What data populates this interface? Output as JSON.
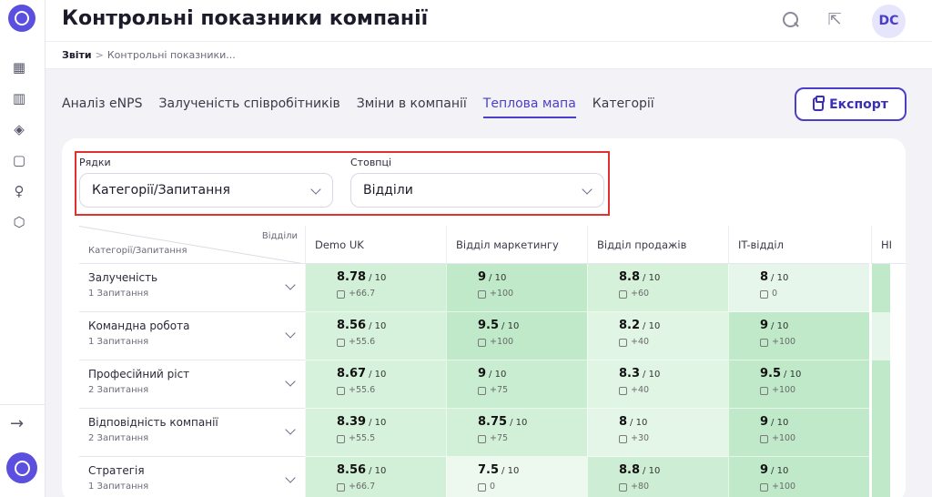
{
  "header": {
    "title": "Контрольні показники компанії",
    "user_initials": "DC"
  },
  "breadcrumb": {
    "root": "Звіти",
    "separator": ">",
    "current": "Контрольні показники..."
  },
  "tabs": [
    {
      "label": "Аналіз eNPS",
      "active": false
    },
    {
      "label": "Залученість співробітників",
      "active": false
    },
    {
      "label": "Зміни в компанії",
      "active": false
    },
    {
      "label": "Теплова мапа",
      "active": true
    },
    {
      "label": "Категорії",
      "active": false
    }
  ],
  "export_label": "Експорт",
  "filters": {
    "rows": {
      "label": "Рядки",
      "value": "Категорії/Запитання"
    },
    "columns": {
      "label": "Стовпці",
      "value": "Відділи"
    }
  },
  "table": {
    "corner_top": "Відділи",
    "corner_bottom": "Категорії/Запитання",
    "columns": [
      "Demo UK",
      "Відділ маркетингу",
      "Відділ продажів",
      "IT-відділ",
      "HI"
    ],
    "rows": [
      {
        "name": "Залученість",
        "sub": "1 Запитання",
        "cells": [
          {
            "score": "8.78",
            "of": "/ 10",
            "delta": "+66.7",
            "color": "#d2f0d8"
          },
          {
            "score": "9",
            "of": "/ 10",
            "delta": "+100",
            "color": "#bfe9c8"
          },
          {
            "score": "8.8",
            "of": "/ 10",
            "delta": "+60",
            "color": "#d5f1da"
          },
          {
            "score": "8",
            "of": "/ 10",
            "delta": "0",
            "color": "#e7f6ea"
          }
        ],
        "edge": "#bfe9c8"
      },
      {
        "name": "Командна робота",
        "sub": "1 Запитання",
        "cells": [
          {
            "score": "8.56",
            "of": "/ 10",
            "delta": "+55.6",
            "color": "#d7f2dc"
          },
          {
            "score": "9.5",
            "of": "/ 10",
            "delta": "+100",
            "color": "#bfe9c8"
          },
          {
            "score": "8.2",
            "of": "/ 10",
            "delta": "+40",
            "color": "#e1f5e5"
          },
          {
            "score": "9",
            "of": "/ 10",
            "delta": "+100",
            "color": "#bfe9c8"
          }
        ],
        "edge": "#e7f6ea"
      },
      {
        "name": "Професійний ріст",
        "sub": "2 Запитання",
        "cells": [
          {
            "score": "8.67",
            "of": "/ 10",
            "delta": "+55.6",
            "color": "#d7f2dc"
          },
          {
            "score": "9",
            "of": "/ 10",
            "delta": "+75",
            "color": "#c9edd1"
          },
          {
            "score": "8.3",
            "of": "/ 10",
            "delta": "+40",
            "color": "#e1f5e5"
          },
          {
            "score": "9.5",
            "of": "/ 10",
            "delta": "+100",
            "color": "#bfe9c8"
          }
        ],
        "edge": "#bfe9c8"
      },
      {
        "name": "Відповідність компанії",
        "sub": "2 Запитання",
        "cells": [
          {
            "score": "8.39",
            "of": "/ 10",
            "delta": "+55.5",
            "color": "#d7f2dc"
          },
          {
            "score": "8.75",
            "of": "/ 10",
            "delta": "+75",
            "color": "#d2f0d8"
          },
          {
            "score": "8",
            "of": "/ 10",
            "delta": "+30",
            "color": "#e4f6e8"
          },
          {
            "score": "9",
            "of": "/ 10",
            "delta": "+100",
            "color": "#bfe9c8"
          }
        ],
        "edge": "#bfe9c8"
      },
      {
        "name": "Стратегія",
        "sub": "1 Запитання",
        "cells": [
          {
            "score": "8.56",
            "of": "/ 10",
            "delta": "+66.7",
            "color": "#d2f0d8"
          },
          {
            "score": "7.5",
            "of": "/ 10",
            "delta": "0",
            "color": "#edf8ef"
          },
          {
            "score": "8.8",
            "of": "/ 10",
            "delta": "+80",
            "color": "#cdeed4"
          },
          {
            "score": "9",
            "of": "/ 10",
            "delta": "+100",
            "color": "#bfe9c8"
          }
        ],
        "edge": "#bfe9c8"
      }
    ]
  },
  "icons": {
    "rail": [
      "grid-icon",
      "books-icon",
      "graduation-cap-icon",
      "feedback-icon",
      "lightbulb-icon",
      "settings-hex-icon"
    ],
    "expand": "arrow-right-icon",
    "search": "search-icon",
    "external": "external-link-icon"
  }
}
